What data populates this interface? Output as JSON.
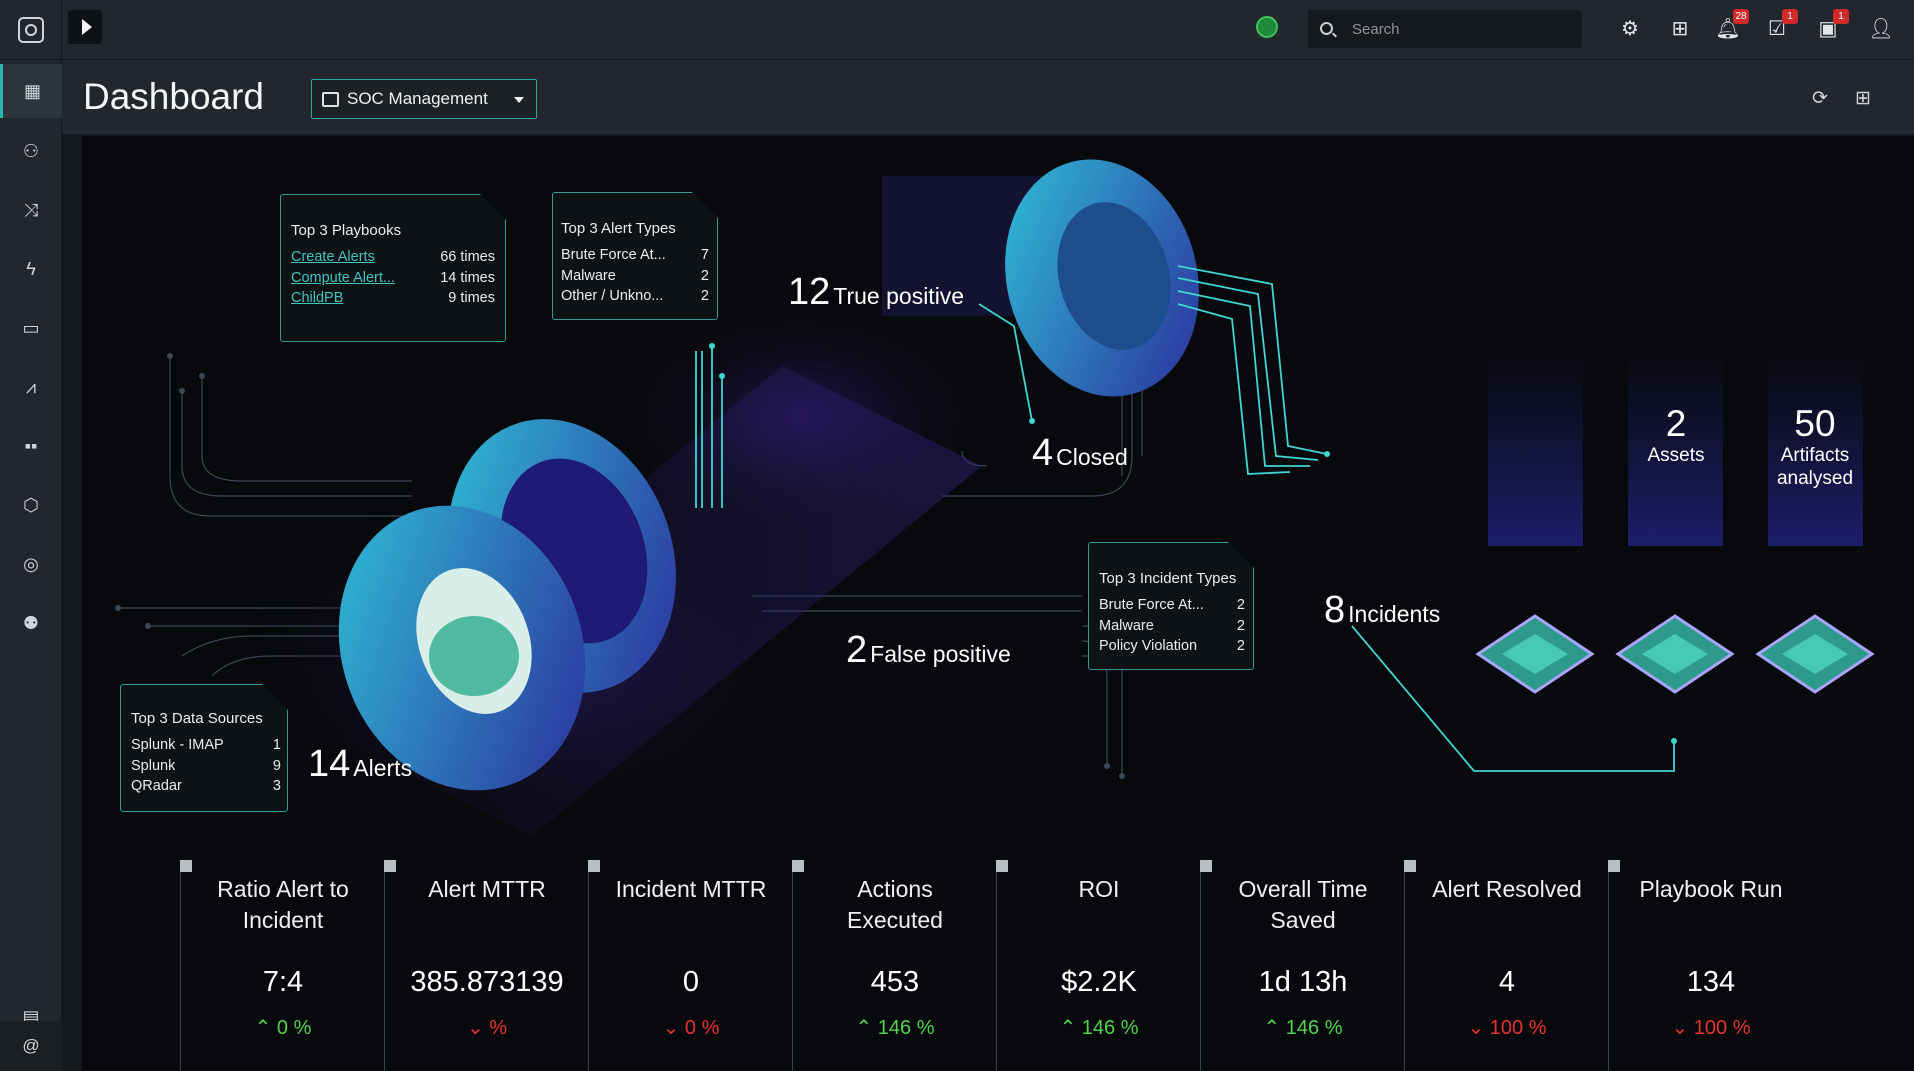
{
  "topbar": {
    "search_placeholder": "Search",
    "badges": {
      "notifications": "28",
      "tasks": "1",
      "queue": "1"
    }
  },
  "header": {
    "title": "Dashboard",
    "view_selector": "SOC Management"
  },
  "nav_icons": [
    "dashboard-icon",
    "users-icon",
    "shuffle-icon",
    "lightning-icon",
    "briefcase-icon",
    "chart-icon",
    "apps-icon",
    "shield-icon",
    "support-icon",
    "team-icon"
  ],
  "cards": {
    "playbooks": {
      "title": "Top 3 Playbooks",
      "rows": [
        {
          "name": "Create Alerts",
          "value": "66 times"
        },
        {
          "name": "Compute Alert...",
          "value": "14 times"
        },
        {
          "name": "ChildPB",
          "value": "9 times"
        }
      ]
    },
    "alert_types": {
      "title": "Top 3 Alert Types",
      "rows": [
        {
          "name": "Brute Force At...",
          "value": "7"
        },
        {
          "name": "Malware",
          "value": "2"
        },
        {
          "name": "Other / Unkno...",
          "value": "2"
        }
      ]
    },
    "incident_types": {
      "title": "Top 3 Incident Types",
      "rows": [
        {
          "name": "Brute Force At...",
          "value": "2"
        },
        {
          "name": "Malware",
          "value": "2"
        },
        {
          "name": "Policy Violation",
          "value": "2"
        }
      ]
    },
    "data_sources": {
      "title": "Top 3 Data Sources",
      "rows": [
        {
          "name": "Splunk - IMAP",
          "value": "1"
        },
        {
          "name": "Splunk",
          "value": "9"
        },
        {
          "name": "QRadar",
          "value": "3"
        }
      ]
    }
  },
  "metrics": {
    "true_positive": {
      "value": "12",
      "label": "True positive"
    },
    "closed": {
      "value": "4",
      "label": "Closed"
    },
    "false_positive": {
      "value": "2",
      "label": "False positive"
    },
    "alerts": {
      "value": "14",
      "label": "Alerts"
    },
    "incidents": {
      "value": "8",
      "label": "Incidents"
    },
    "assets": {
      "value": "2",
      "label": "Assets"
    },
    "artifacts": {
      "value": "50",
      "label": "Artifacts analysed"
    }
  },
  "kpis": [
    {
      "title": "Ratio Alert to Incident",
      "value": "7:4",
      "change": "0 %",
      "trend": "up"
    },
    {
      "title": "Alert MTTR",
      "value": "385.873139",
      "change": "%",
      "trend": "down"
    },
    {
      "title": "Incident MTTR",
      "value": "0",
      "change": "0 %",
      "trend": "down"
    },
    {
      "title": "Actions Executed",
      "value": "453",
      "change": "146 %",
      "trend": "up"
    },
    {
      "title": "ROI",
      "value": "$2.2K",
      "change": "146 %",
      "trend": "up"
    },
    {
      "title": "Overall Time Saved",
      "value": "1d 13h",
      "change": "146 %",
      "trend": "up"
    },
    {
      "title": "Alert Resolved",
      "value": "4",
      "change": "100 %",
      "trend": "down"
    },
    {
      "title": "Playbook Run",
      "value": "134",
      "change": "100 %",
      "trend": "down"
    }
  ],
  "colors": {
    "accent": "#25b7b0",
    "up": "#52d34c",
    "down": "#e3342f"
  }
}
